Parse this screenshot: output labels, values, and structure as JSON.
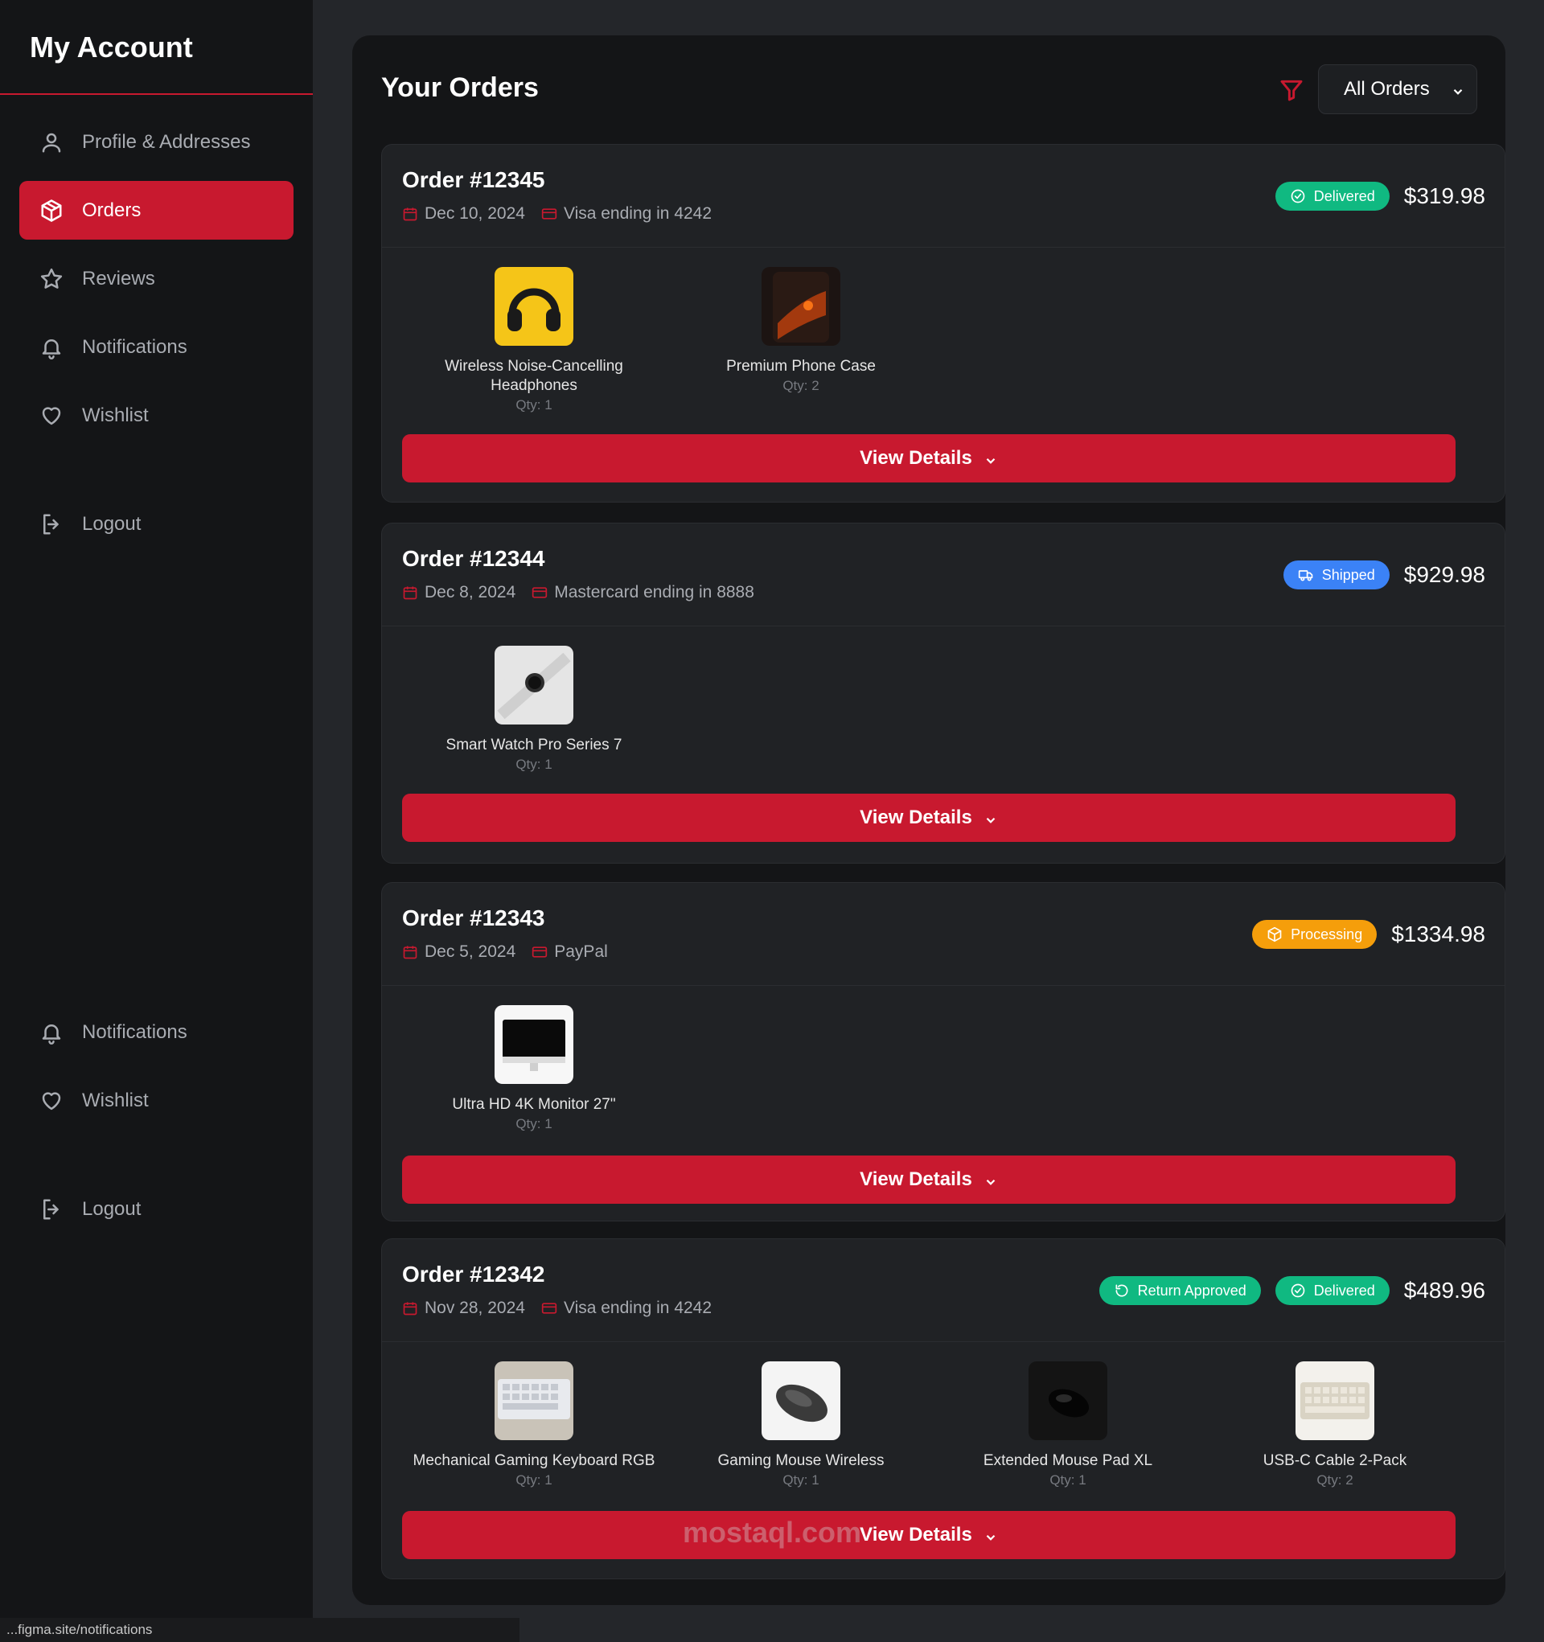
{
  "sidebar": {
    "title": "My Account",
    "items": [
      {
        "label": "Profile & Addresses",
        "icon": "user-icon"
      },
      {
        "label": "Orders",
        "icon": "box-icon",
        "active": true
      },
      {
        "label": "Reviews",
        "icon": "star-icon"
      },
      {
        "label": "Notifications",
        "icon": "bell-icon"
      },
      {
        "label": "Wishlist",
        "icon": "heart-icon"
      }
    ],
    "logout_label": "Logout",
    "bottom_items": [
      {
        "label": "Notifications",
        "icon": "bell-icon"
      },
      {
        "label": "Wishlist",
        "icon": "heart-icon"
      }
    ],
    "bottom_logout_label": "Logout"
  },
  "orders_page": {
    "title": "Your Orders",
    "filter_icon": "filter-icon",
    "filter_select": {
      "selected": "All Orders"
    }
  },
  "orders": [
    {
      "id": "Order #12345",
      "date": "Dec 10, 2024",
      "payment": "Visa ending in 4242",
      "badges": [
        {
          "label": "Delivered",
          "color": "#10b981",
          "icon": "check-circle-icon"
        }
      ],
      "total": "$319.98",
      "items": [
        {
          "name": "Wireless Noise-Cancelling Headphones",
          "qty": "Qty: 1",
          "thumb": "headphones"
        },
        {
          "name": "Premium Phone Case",
          "qty": "Qty: 2",
          "thumb": "phone"
        }
      ],
      "action": "View Details"
    },
    {
      "id": "Order #12344",
      "date": "Dec 8, 2024",
      "payment": "Mastercard ending in 8888",
      "badges": [
        {
          "label": "Shipped",
          "color": "#3b82f6",
          "icon": "truck-icon"
        }
      ],
      "total": "$929.98",
      "items": [
        {
          "name": "Smart Watch Pro Series 7",
          "qty": "Qty: 1",
          "thumb": "watch"
        }
      ],
      "action": "View Details"
    },
    {
      "id": "Order #12343",
      "date": "Dec 5, 2024",
      "payment": "PayPal",
      "badges": [
        {
          "label": "Processing",
          "color": "#f59e0b",
          "icon": "box-icon"
        }
      ],
      "total": "$1334.98",
      "items": [
        {
          "name": "Ultra HD 4K Monitor 27\"",
          "qty": "Qty: 1",
          "thumb": "monitor"
        }
      ],
      "action": "View Details"
    },
    {
      "id": "Order #12342",
      "date": "Nov 28, 2024",
      "payment": "Visa ending in 4242",
      "badges": [
        {
          "label": "Return Approved",
          "color": "#10b981",
          "icon": "refresh-icon"
        },
        {
          "label": "Delivered",
          "color": "#10b981",
          "icon": "check-circle-icon"
        }
      ],
      "total": "$489.96",
      "items": [
        {
          "name": "Mechanical Gaming Keyboard RGB",
          "qty": "Qty: 1",
          "thumb": "keyboard"
        },
        {
          "name": "Gaming Mouse Wireless",
          "qty": "Qty: 1",
          "thumb": "mouse"
        },
        {
          "name": "Extended Mouse Pad XL",
          "qty": "Qty: 1",
          "thumb": "mousepad"
        },
        {
          "name": "USB-C Cable 2-Pack",
          "qty": "Qty: 2",
          "thumb": "keyboard-light"
        }
      ],
      "action": "View Details"
    }
  ],
  "status_bar": {
    "url": "...figma.site/notifications"
  },
  "watermark": {
    "text": "mostaql.com"
  },
  "colors": {
    "accent": "#c8192f",
    "background": "#24262a",
    "panel": "#141517",
    "card": "#202225"
  }
}
